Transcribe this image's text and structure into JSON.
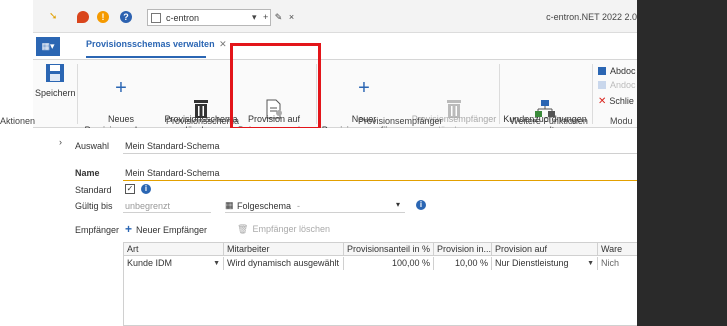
{
  "quick_access": {
    "combo_value": "c-entron",
    "combo_tools": "▾ + ✎ ×",
    "app_title": "c-entron.NET 2022 2.0"
  },
  "tabs": {
    "app_menu_label": "▦▾",
    "document_tab": "Provisionsschemas verwalten",
    "document_tab_close": "✕"
  },
  "ribbon": {
    "buttons": [
      {
        "label": "Speichern",
        "icon": "save-icon"
      },
      {
        "label": "Neues\nProvisionsschema",
        "icon": "plus-icon"
      },
      {
        "label": "Provisionsschema\nlöschen",
        "icon": "trash-icon"
      },
      {
        "label": "Provision auf\nBelege anwenden",
        "icon": "document-apply-icon"
      },
      {
        "label": "Neuer\nProvisionsempfänger",
        "icon": "plus-icon"
      },
      {
        "label": "Provisionsempfänger\nlöschen",
        "icon": "trash-icon"
      },
      {
        "label": "Kundenzuordnungen\nverwalten",
        "icon": "org-chart-icon"
      }
    ],
    "small_buttons": [
      {
        "label": "Abdoc",
        "enabled": true
      },
      {
        "label": "Andoc",
        "enabled": false
      },
      {
        "label": "Schlie",
        "enabled": true
      }
    ],
    "groups": [
      "Aktionen",
      "Provisionsschema",
      "Provisionsempfänger",
      "Weitere Funktionen",
      "Modu"
    ],
    "colors": {
      "accent": "#2b66b3",
      "highlight": "#e3151a"
    }
  },
  "form": {
    "auswahl_label": "Auswahl",
    "auswahl_value": "Mein Standard-Schema",
    "name_label": "Name",
    "name_value": "Mein Standard-Schema",
    "standard_label": "Standard",
    "standard_checked": "✓",
    "gueltig_label": "Gültig bis",
    "gueltig_value": "unbegrenzt",
    "folgeschema_label": "Folgeschema",
    "folgeschema_value": "-",
    "empfaenger_label": "Empfänger",
    "new_recipient_button": "Neuer Empfänger",
    "delete_recipient_button": "Empfänger löschen"
  },
  "grid": {
    "columns": [
      "Art",
      "Mitarbeiter",
      "Provisionsanteil in %",
      "Provision in...",
      "Provision auf",
      "Ware"
    ],
    "rows": [
      [
        "Kunde IDM",
        "Wird dynamisch ausgewählt",
        "100,00 %",
        "10,00 %",
        "Nur Dienstleistung",
        "Nich"
      ]
    ]
  }
}
